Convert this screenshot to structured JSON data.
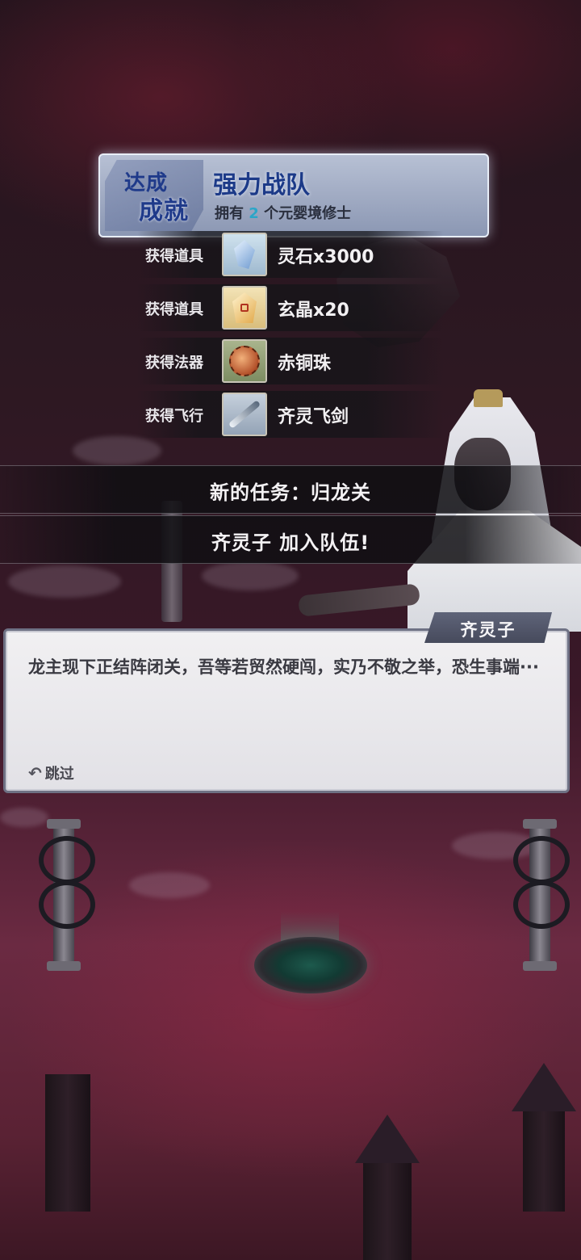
{
  "achievement": {
    "badge_line1": "达成",
    "badge_line2": "成就",
    "title": "强力战队",
    "desc_prefix": "拥有 ",
    "desc_count": "2",
    "desc_suffix": " 个元婴境修士"
  },
  "rewards": [
    {
      "label": "获得道具",
      "name": "灵石x3000",
      "icon": "spirit-stone-icon"
    },
    {
      "label": "获得道具",
      "name": "玄晶x20",
      "icon": "mystic-crystal-icon"
    },
    {
      "label": "获得法器",
      "name": "赤铜珠",
      "icon": "copper-bead-icon"
    },
    {
      "label": "获得飞行",
      "name": "齐灵飞剑",
      "icon": "flying-sword-icon"
    }
  ],
  "banners": {
    "new_quest": "新的任务：归龙关",
    "join_party": "齐灵子 加入队伍!"
  },
  "dialog": {
    "speaker": "齐灵子",
    "text": "龙主现下正结阵闭关，吾等若贸然硬闯，实乃不敬之举，恐生事端···",
    "skip_label": "跳过"
  },
  "colors": {
    "achievement_title": "#1c3a88",
    "highlight": "#2aa6c8",
    "sky": "#3a1828"
  }
}
